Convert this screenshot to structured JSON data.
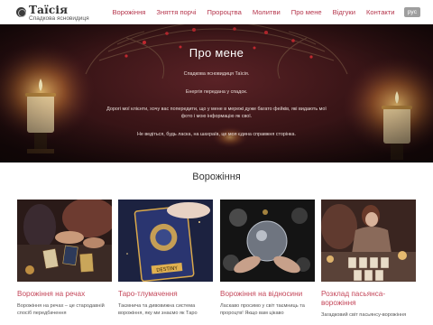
{
  "brand": {
    "name": "Таїсія",
    "subtitle": "Спадкова ясновидиця"
  },
  "nav": {
    "items": [
      {
        "label": "Ворожіння"
      },
      {
        "label": "Зняття порчі"
      },
      {
        "label": "Пророцтва"
      },
      {
        "label": "Молитви"
      },
      {
        "label": "Про мене"
      },
      {
        "label": "Відгуки"
      },
      {
        "label": "Контакти"
      }
    ],
    "lang": "рус",
    "link_color": "#b5364c"
  },
  "hero": {
    "title": "Про мене",
    "paragraphs": [
      "Спадкова ясновидиця Таїсія.",
      "Енергія передана у спадок.",
      "Дорогі мої клієнти, хочу вас попередити, що у мене в мережі дуже багато фейків, які видають мої фото і мою інформацію як свої.",
      "Не ведіться, будь ласка, на шахраїв, це моя єдина справжня сторінка."
    ]
  },
  "section": {
    "title": "Ворожіння"
  },
  "cards": [
    {
      "title": "Ворожіння на речах",
      "text": "Ворожіння на речах – це стародавній спосіб передбачення",
      "image": "fortune-teller-hands-cards-image"
    },
    {
      "title": "Таро-тлумачення",
      "text": "Таємнича та дивовижна система ворожіння, яку ми знаємо як Таро",
      "image": "tarot-destiny-card-image"
    },
    {
      "title": "Ворожіння на відносини",
      "text": "Ласкаво просимо у світ таємниць та пророцтв! Якщо вам цікаво",
      "image": "crystal-ball-hands-image"
    },
    {
      "title": "Розклад пасьянса-ворожіння",
      "text": "Загадковий світ пасьянсу-ворожіння",
      "image": "woman-laying-cards-image"
    }
  ],
  "colors": {
    "accent": "#c4475a",
    "hero_bg": "#3a1517"
  }
}
